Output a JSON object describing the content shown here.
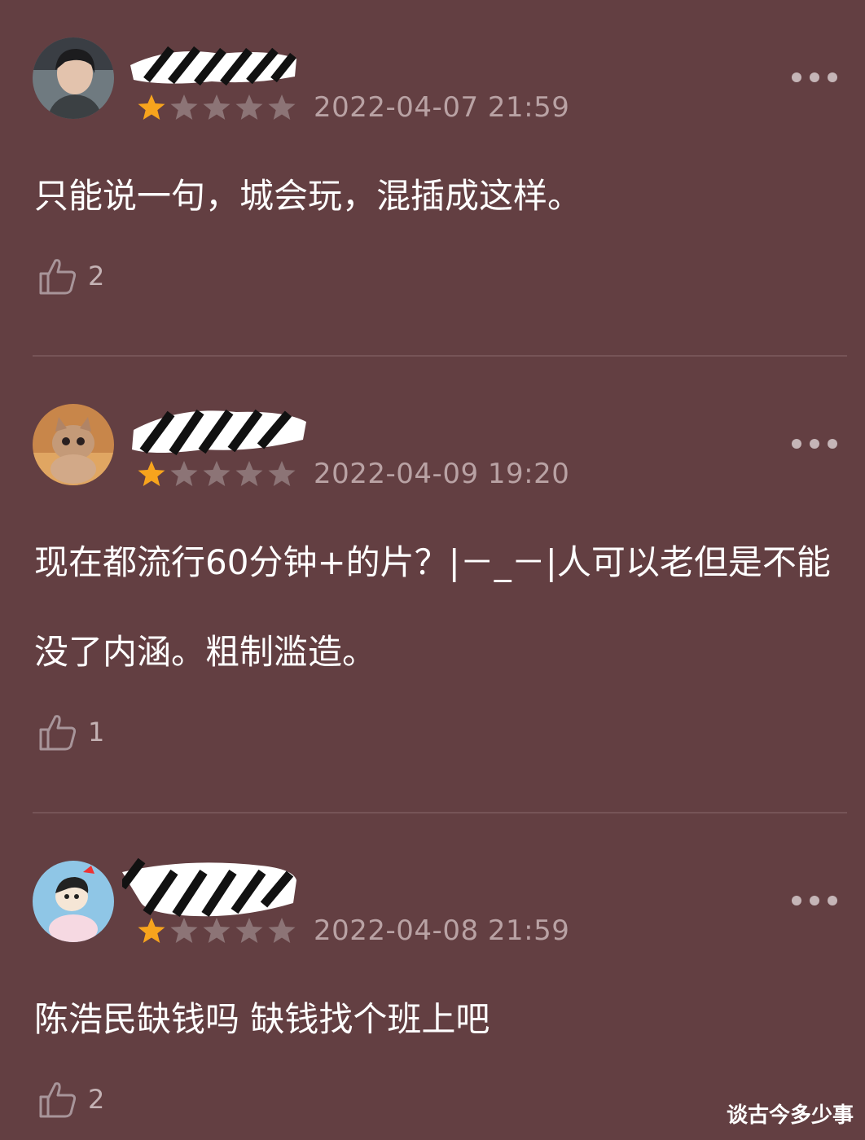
{
  "reviews": [
    {
      "date": "2022-04-07 21:59",
      "rating": 1,
      "rating_max": 5,
      "comment": "只能说一句，城会玩，混插成这样。",
      "likes": "2",
      "avatar_icon": "person-photo-icon"
    },
    {
      "date": "2022-04-09 19:20",
      "rating": 1,
      "rating_max": 5,
      "comment": "现在都流行60分钟+的片？|－_－|人可以老但是不能没了内涵。粗制滥造。",
      "likes": "1",
      "avatar_icon": "cat-photo-icon"
    },
    {
      "date": "2022-04-08 21:59",
      "rating": 1,
      "rating_max": 5,
      "comment": "陈浩民缺钱吗 缺钱找个班上吧",
      "likes": "2",
      "avatar_icon": "cartoon-avatar-icon"
    }
  ],
  "watermark": "谈古今多少事",
  "colors": {
    "background": "#633f42",
    "star_filled": "#f7a41d",
    "star_empty": "#8c7476",
    "date_text": "#b9a2a4",
    "divider": "#765457"
  }
}
